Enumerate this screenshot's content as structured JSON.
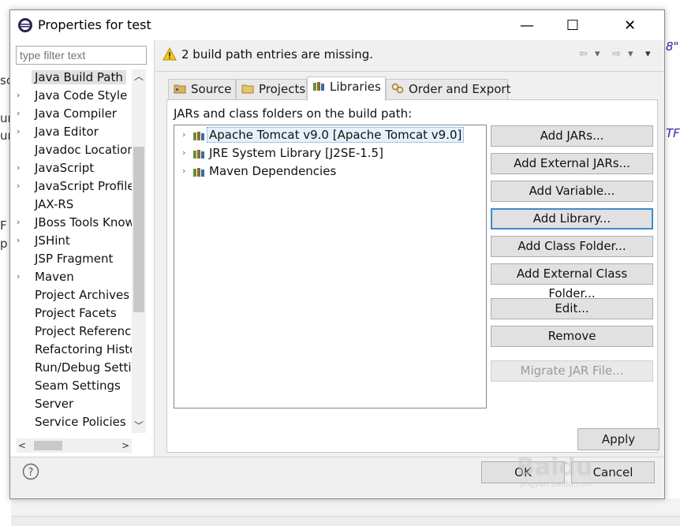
{
  "background": {
    "left_fragments": [
      "sc",
      "ur",
      "ur",
      "F",
      "p"
    ],
    "right_fragments": [
      "8\"",
      "TF"
    ]
  },
  "dialog": {
    "title": "Properties for test",
    "window_buttons": {
      "minimize": "—",
      "maximize": "☐",
      "close": "✕"
    }
  },
  "left": {
    "filter_placeholder": "type filter text",
    "items": [
      {
        "label": "Java Build Path",
        "expandable": false,
        "selected": true
      },
      {
        "label": "Java Code Style",
        "expandable": true
      },
      {
        "label": "Java Compiler",
        "expandable": true
      },
      {
        "label": "Java Editor",
        "expandable": true
      },
      {
        "label": "Javadoc Location",
        "expandable": false
      },
      {
        "label": "JavaScript",
        "expandable": true
      },
      {
        "label": "JavaScript Profile",
        "expandable": true
      },
      {
        "label": "JAX-RS",
        "expandable": false
      },
      {
        "label": "JBoss Tools Knowledge",
        "expandable": true
      },
      {
        "label": "JSHint",
        "expandable": true
      },
      {
        "label": "JSP Fragment",
        "expandable": false
      },
      {
        "label": "Maven",
        "expandable": true
      },
      {
        "label": "Project Archives",
        "expandable": false
      },
      {
        "label": "Project Facets",
        "expandable": false
      },
      {
        "label": "Project References",
        "expandable": false
      },
      {
        "label": "Refactoring History",
        "expandable": false
      },
      {
        "label": "Run/Debug Settings",
        "expandable": false
      },
      {
        "label": "Seam Settings",
        "expandable": false
      },
      {
        "label": "Server",
        "expandable": false
      },
      {
        "label": "Service Policies",
        "expandable": false
      }
    ]
  },
  "right": {
    "message": "2 build path entries are missing.",
    "tabs": [
      {
        "label": "Source",
        "active": false
      },
      {
        "label": "Projects",
        "active": false
      },
      {
        "label": "Libraries",
        "active": true
      },
      {
        "label": "Order and Export",
        "active": false
      }
    ],
    "tab_label": "JARs and class folders on the build path:",
    "libraries": [
      {
        "label": "Apache Tomcat v9.0 [Apache Tomcat v9.0]",
        "selected": true
      },
      {
        "label": "JRE System Library [J2SE-1.5]",
        "selected": false
      },
      {
        "label": "Maven Dependencies",
        "selected": false
      }
    ],
    "buttons": {
      "add_jars": "Add JARs...",
      "add_external_jars": "Add External JARs...",
      "add_variable": "Add Variable...",
      "add_library": "Add Library...",
      "add_class_folder": "Add Class Folder...",
      "add_external_class_folder": "Add External Class Folder...",
      "edit": "Edit...",
      "remove": "Remove",
      "migrate": "Migrate JAR File..."
    },
    "apply": "Apply"
  },
  "footer": {
    "ok": "OK",
    "cancel": "Cancel"
  },
  "watermark": {
    "brand": "Baidu",
    "url": "jingyan.baidu.com"
  }
}
